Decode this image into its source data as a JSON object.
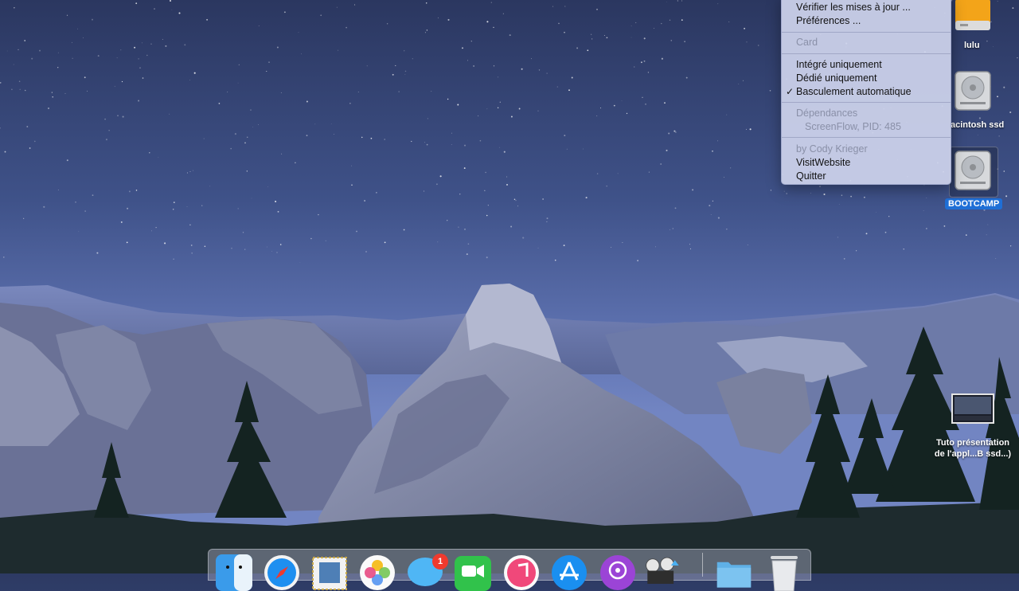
{
  "menu": {
    "items": [
      {
        "label": "Vérifier les mises à jour ...",
        "enabled": true
      },
      {
        "label": "Préférences ...",
        "enabled": true
      },
      {
        "label": "Card",
        "enabled": false
      },
      {
        "label": "Intégré uniquement",
        "enabled": true
      },
      {
        "label": "Dédié uniquement",
        "enabled": true
      },
      {
        "label": "Basculement automatique",
        "enabled": true,
        "checked": true
      },
      {
        "label": "Dépendances",
        "enabled": false
      },
      {
        "label": "ScreenFlow, PID: 485",
        "enabled": false
      },
      {
        "label": "by Cody Krieger",
        "enabled": false
      },
      {
        "label": "VisitWebsite",
        "enabled": true
      },
      {
        "label": "Quitter",
        "enabled": true
      }
    ],
    "checkmark": "✓"
  },
  "desktop_icons": [
    {
      "label": "lulu",
      "icon": "external-drive-icon"
    },
    {
      "label": "acintosh ssd",
      "icon": "hard-drive-icon"
    },
    {
      "label": "BOOTCAMP",
      "icon": "hard-drive-icon",
      "selected": true
    },
    {
      "label_line1": "Tuto présentation",
      "label_line2": "de l'appl...B ssd...)",
      "icon": "video-file-icon"
    }
  ],
  "dock": {
    "apps": [
      "finder-icon",
      "safari-icon",
      "mail-icon",
      "photos-icon",
      "messages-icon",
      "facetime-icon",
      "itunes-icon",
      "app-store-icon",
      "podcasts-icon",
      "photo-booth-icon",
      "folder-icon",
      "trash-icon"
    ],
    "messages_badge": "1"
  }
}
